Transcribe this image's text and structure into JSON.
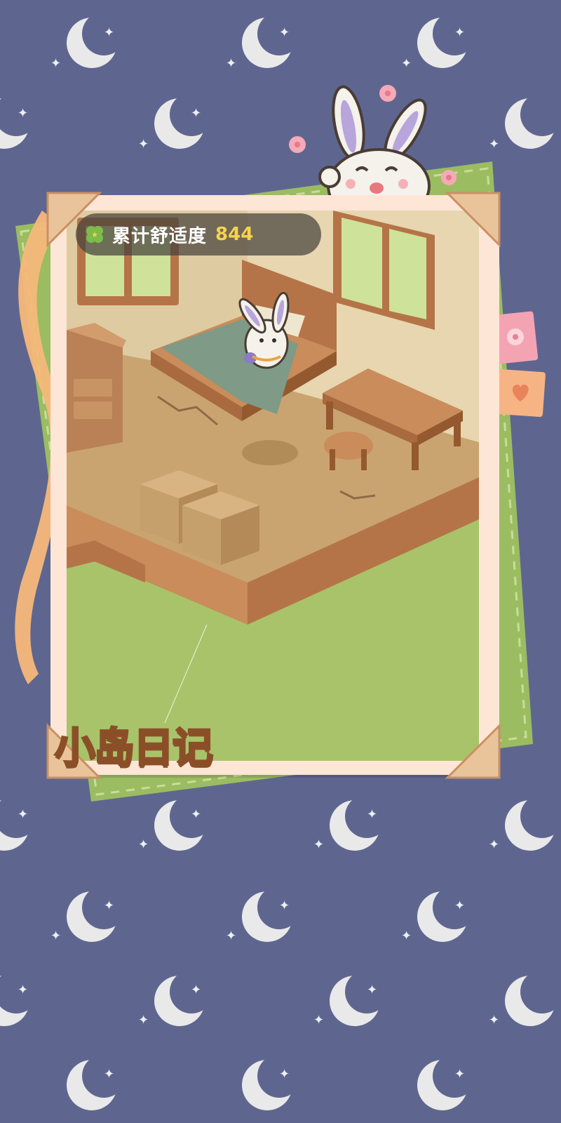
{
  "game": {
    "comfort_label": "累计舒适度",
    "comfort_value": "844",
    "logo_text": "小岛日记"
  },
  "colors": {
    "background": "#5e6690",
    "moon": "#e9e9ea",
    "frame": "#fde6d6",
    "grass": "#a9c36a",
    "wood": "#c98c5a",
    "floor": "#caa470",
    "hud_bg": "#4f4a45",
    "hud_value": "#f7d24c"
  },
  "icons": [
    "moon-icon",
    "sparkle-icon",
    "clover-icon",
    "rabbit-character",
    "flower-icon",
    "heart-icon"
  ]
}
